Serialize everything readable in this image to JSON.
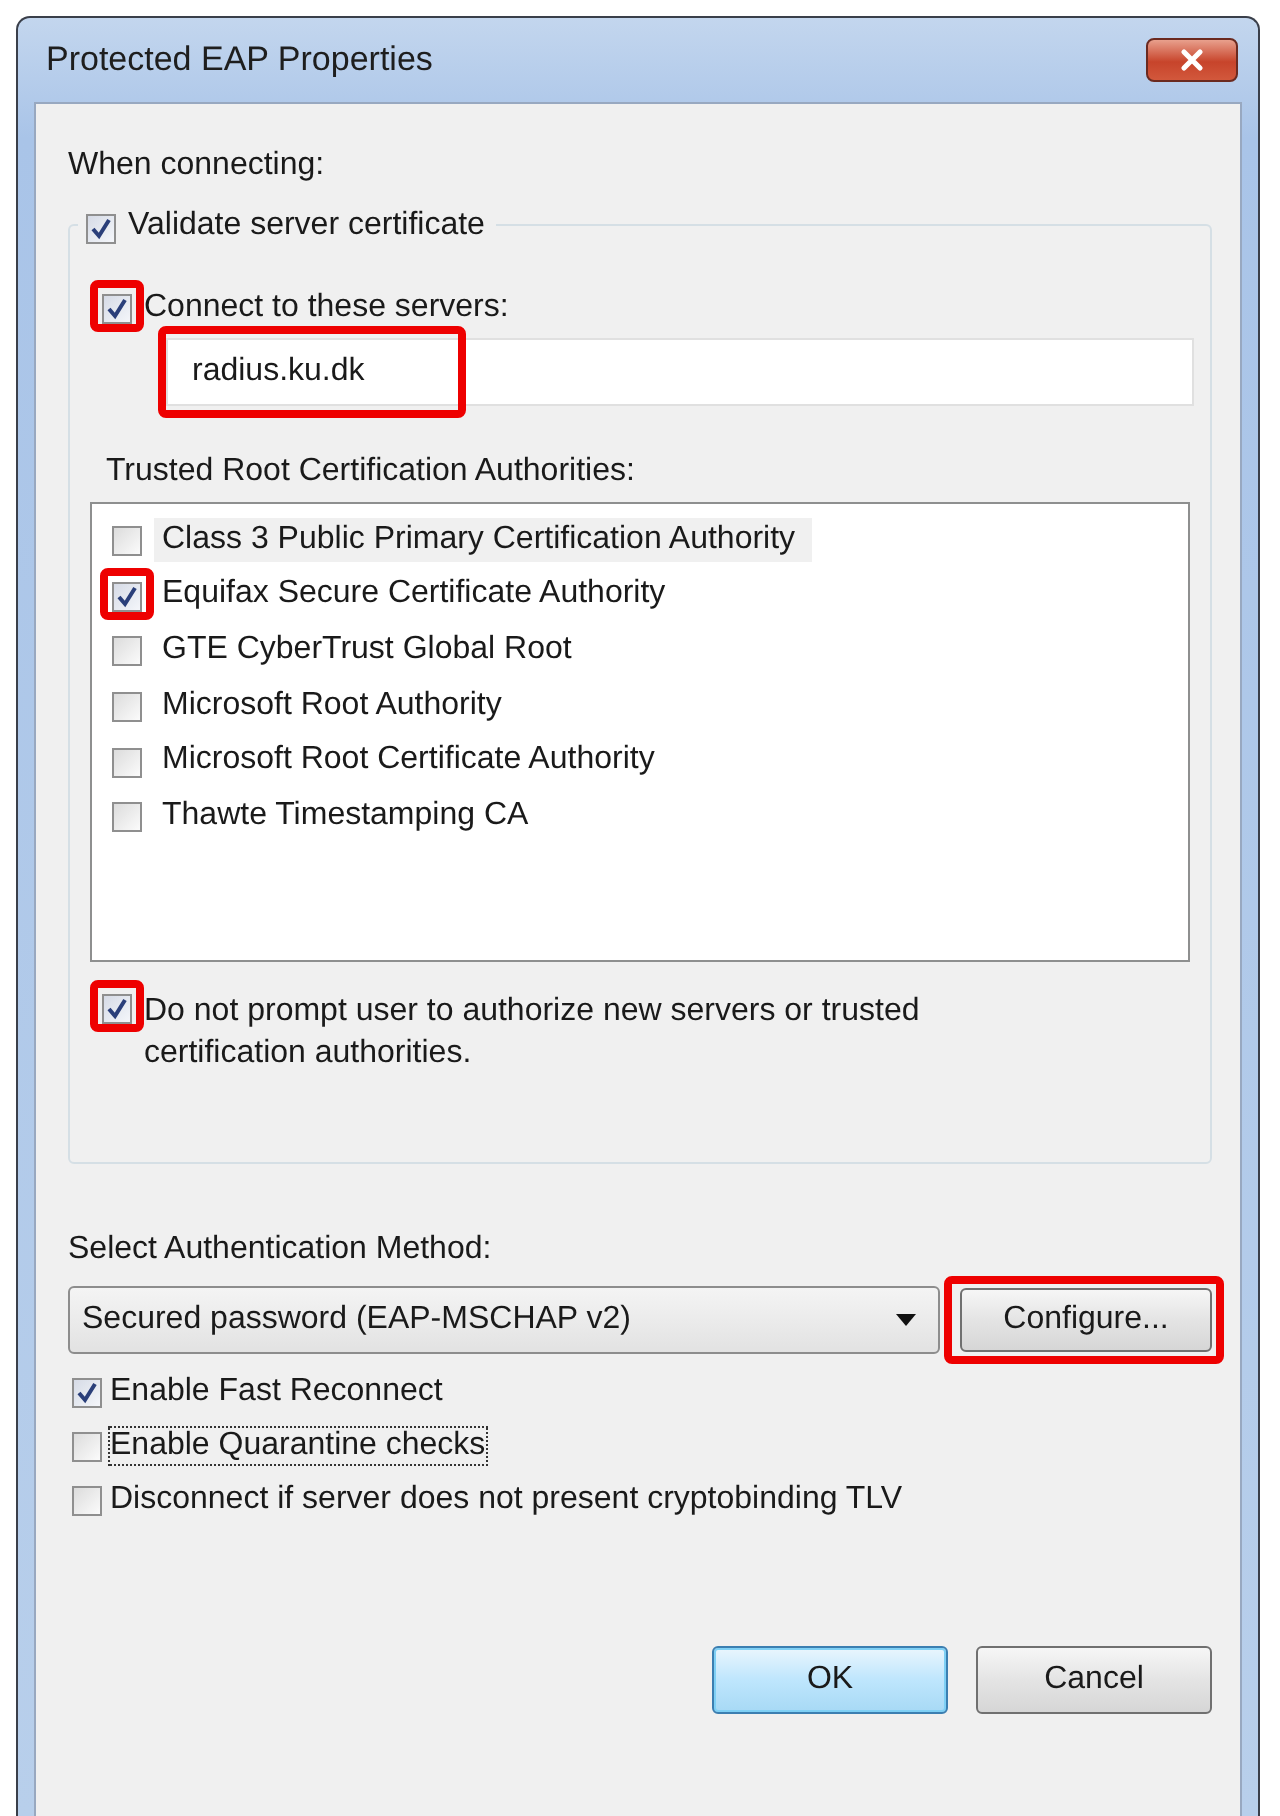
{
  "window": {
    "title": "Protected EAP Properties"
  },
  "when_connecting_label": "When connecting:",
  "validate": {
    "label": "Validate server certificate",
    "checked": true
  },
  "connect": {
    "label": "Connect to these servers:",
    "checked": true,
    "highlighted": true
  },
  "servers_field": {
    "value": "radius.ku.dk",
    "highlighted": true
  },
  "trusted_label": "Trusted Root Certification Authorities:",
  "authorities": [
    {
      "label": "Class 3 Public Primary Certification Authority",
      "checked": false,
      "highlighted": false,
      "selected": true
    },
    {
      "label": "Equifax Secure Certificate Authority",
      "checked": true,
      "highlighted": true,
      "selected": false
    },
    {
      "label": "GTE CyberTrust Global Root",
      "checked": false,
      "highlighted": false,
      "selected": false
    },
    {
      "label": "Microsoft Root Authority",
      "checked": false,
      "highlighted": false,
      "selected": false
    },
    {
      "label": "Microsoft Root Certificate Authority",
      "checked": false,
      "highlighted": false,
      "selected": false
    },
    {
      "label": "Thawte Timestamping CA",
      "checked": false,
      "highlighted": false,
      "selected": false
    }
  ],
  "no_prompt": {
    "label": "Do not prompt user to authorize new servers or trusted certification authorities.",
    "checked": true,
    "highlighted": true
  },
  "auth_method_label": "Select Authentication Method:",
  "auth_method": {
    "value": "Secured password (EAP-MSCHAP v2)"
  },
  "configure_button": {
    "label": "Configure...",
    "highlighted": true
  },
  "options": [
    {
      "label": "Enable Fast Reconnect",
      "checked": true,
      "focused": false
    },
    {
      "label": "Enable Quarantine checks",
      "checked": false,
      "focused": true
    },
    {
      "label": "Disconnect if server does not present cryptobinding TLV",
      "checked": false,
      "focused": false
    }
  ],
  "buttons": [
    {
      "label": "OK",
      "default": true
    },
    {
      "label": "Cancel",
      "default": false
    }
  ]
}
